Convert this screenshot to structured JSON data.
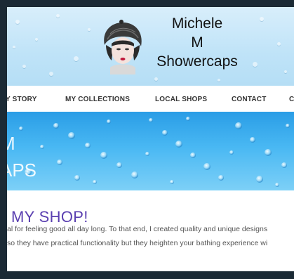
{
  "brand": {
    "line1": "Michele",
    "line2": "M",
    "line3": "Showercaps"
  },
  "logo": {
    "icon": "woman-in-showercap-portrait"
  },
  "nav": {
    "items": [
      {
        "label": "Y STORY"
      },
      {
        "label": "MY COLLECTIONS"
      },
      {
        "label": "LOCAL SHOPS"
      },
      {
        "label": "CONTACT"
      },
      {
        "label": "C"
      }
    ]
  },
  "hero": {
    "line1": "M",
    "line2": "APS"
  },
  "main": {
    "heading": ") MY SHOP!",
    "line1": "al for feeling good all day long. To that end, I created quality and unique designs",
    "line2": "so they have practical functionality but they heighten your bathing experience wi"
  },
  "colors": {
    "heading": "#5a3fb0",
    "hero_blue": "#2a9de6",
    "frame": "#1b2a35"
  }
}
